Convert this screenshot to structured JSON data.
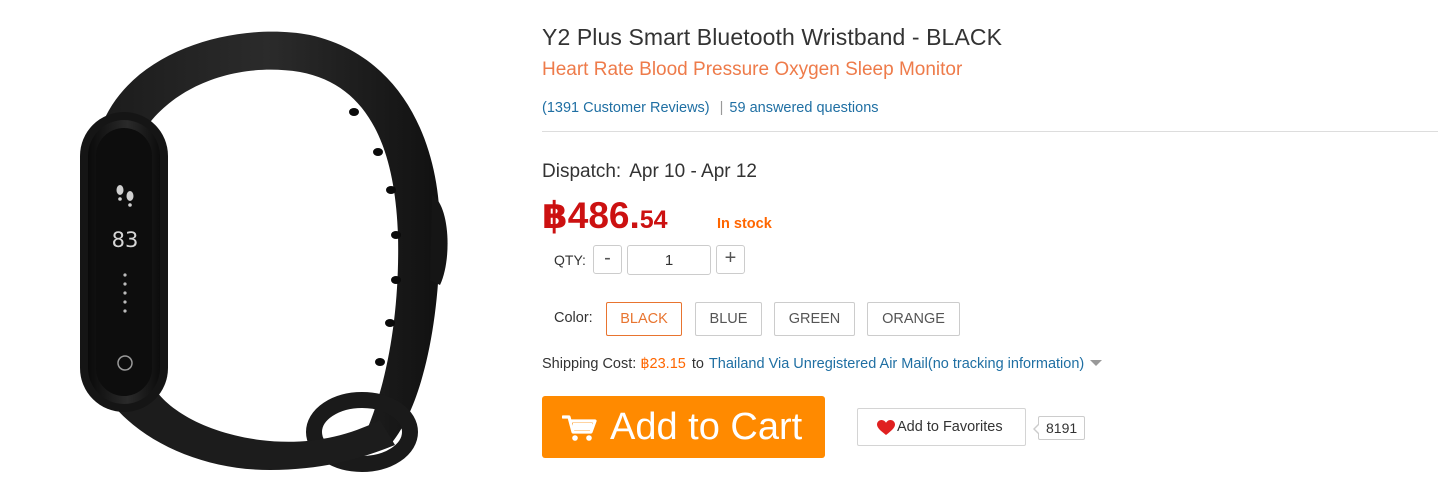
{
  "product": {
    "image_alt": "black smart wristband",
    "screen_number": "83"
  },
  "title": "Y2 Plus Smart Bluetooth Wristband  -  BLACK",
  "subtitle": "Heart Rate Blood Pressure Oxygen Sleep Monitor",
  "reviews": {
    "count_label": "(1391 Customer Reviews)",
    "separator": "|",
    "questions_label": "59 answered questions"
  },
  "dispatch": {
    "label": "Dispatch:",
    "dates": "Apr 10 - Apr 12"
  },
  "price": {
    "main": "฿486.",
    "cents": "54",
    "stock": "In stock"
  },
  "quantity": {
    "label": "QTY:",
    "minus": "-",
    "value": "1",
    "plus": "+"
  },
  "color": {
    "label": "Color:",
    "options": [
      "BLACK",
      "BLUE",
      "GREEN",
      "ORANGE"
    ],
    "selected": "BLACK"
  },
  "shipping": {
    "label": "Shipping Cost:",
    "cost": "฿23.15",
    "to": "to",
    "method": "Thailand Via Unregistered Air Mail(no tracking information)"
  },
  "actions": {
    "add_to_cart": "Add to Cart",
    "add_to_favorites": "Add to Favorites",
    "favorites_count": "8191"
  },
  "colors": {
    "accent_orange": "#ff8a00",
    "price_red": "#cc1111",
    "subtitle_orange": "#ee7b4a",
    "link_blue": "#1f6fa3",
    "heart_red": "#e02020"
  },
  "icons": {
    "cart": "shopping-cart-icon",
    "heart": "heart-icon",
    "dropdown": "caret-down-icon"
  }
}
